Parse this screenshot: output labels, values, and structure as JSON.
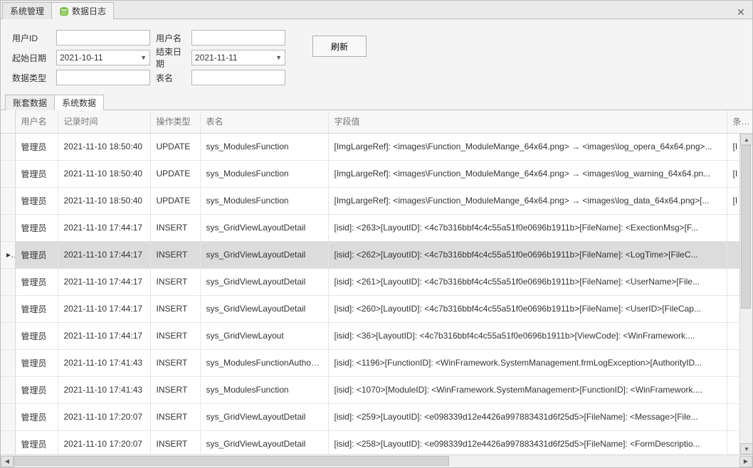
{
  "top_tabs": {
    "sys_mgmt": "系统管理",
    "data_log": "数据日志"
  },
  "close_glyph": "✕",
  "filter": {
    "user_id_label": "用户ID",
    "user_name_label": "用户名",
    "start_date_label": "起始日期",
    "start_date_value": "2021-10-11",
    "end_date_label": "结束日期",
    "end_date_value": "2021-11-11",
    "data_type_label": "数据类型",
    "table_name_label": "表名",
    "refresh_label": "刷新"
  },
  "inner_tabs": {
    "account_data": "账套数据",
    "system_data": "系统数据"
  },
  "grid": {
    "headers": {
      "user": "用户名",
      "time": "记录时间",
      "op": "操作类型",
      "table": "表名",
      "field": "字段值",
      "cond": "条件"
    },
    "row_indicator": "▸",
    "selected_index": 4,
    "rows": [
      {
        "user": "管理员",
        "time": "2021-11-10 18:50:40",
        "op": "UPDATE",
        "table": "sys_ModulesFunction",
        "field": "[ImgLargeRef]: <images\\Function_ModuleMange_64x64.png> → <images\\log_opera_64x64.png>...",
        "cond": "[I"
      },
      {
        "user": "管理员",
        "time": "2021-11-10 18:50:40",
        "op": "UPDATE",
        "table": "sys_ModulesFunction",
        "field": "[ImgLargeRef]: <images\\Function_ModuleMange_64x64.png> → <images\\log_warning_64x64.pn...",
        "cond": "[I"
      },
      {
        "user": "管理员",
        "time": "2021-11-10 18:50:40",
        "op": "UPDATE",
        "table": "sys_ModulesFunction",
        "field": "[ImgLargeRef]: <images\\Function_ModuleMange_64x64.png> → <images\\log_data_64x64.png>[...",
        "cond": "[I"
      },
      {
        "user": "管理员",
        "time": "2021-11-10 17:44:17",
        "op": "INSERT",
        "table": "sys_GridViewLayoutDetail",
        "field": "[isid]: <263>[LayoutID]: <4c7b316bbf4c4c55a51f0e0696b1911b>[FileName]: <ExectionMsg>[F...",
        "cond": ""
      },
      {
        "user": "管理员",
        "time": "2021-11-10 17:44:17",
        "op": "INSERT",
        "table": "sys_GridViewLayoutDetail",
        "field": "[isid]: <262>[LayoutID]: <4c7b316bbf4c4c55a51f0e0696b1911b>[FileName]: <LogTime>[FileC...",
        "cond": ""
      },
      {
        "user": "管理员",
        "time": "2021-11-10 17:44:17",
        "op": "INSERT",
        "table": "sys_GridViewLayoutDetail",
        "field": "[isid]: <261>[LayoutID]: <4c7b316bbf4c4c55a51f0e0696b1911b>[FileName]: <UserName>[File...",
        "cond": ""
      },
      {
        "user": "管理员",
        "time": "2021-11-10 17:44:17",
        "op": "INSERT",
        "table": "sys_GridViewLayoutDetail",
        "field": "[isid]: <260>[LayoutID]: <4c7b316bbf4c4c55a51f0e0696b1911b>[FileName]: <UserID>[FileCap...",
        "cond": ""
      },
      {
        "user": "管理员",
        "time": "2021-11-10 17:44:17",
        "op": "INSERT",
        "table": "sys_GridViewLayout",
        "field": "[isid]: <36>[LayoutID]: <4c7b316bbf4c4c55a51f0e0696b1911b>[ViewCode]: <WinFramework....",
        "cond": ""
      },
      {
        "user": "管理员",
        "time": "2021-11-10 17:41:43",
        "op": "INSERT",
        "table": "sys_ModulesFunctionAuthority",
        "field": "[isid]: <1196>[FunctionID]: <WinFramework.SystemManagement.frmLogException>[AuthorityID...",
        "cond": ""
      },
      {
        "user": "管理员",
        "time": "2021-11-10 17:41:43",
        "op": "INSERT",
        "table": "sys_ModulesFunction",
        "field": "[isid]: <1070>[ModuleID]: <WinFramework.SystemManagement>[FunctionID]: <WinFramework....",
        "cond": ""
      },
      {
        "user": "管理员",
        "time": "2021-11-10 17:20:07",
        "op": "INSERT",
        "table": "sys_GridViewLayoutDetail",
        "field": "[isid]: <259>[LayoutID]: <e098339d12e4426a997883431d6f25d5>[FileName]: <Message>[File...",
        "cond": ""
      },
      {
        "user": "管理员",
        "time": "2021-11-10 17:20:07",
        "op": "INSERT",
        "table": "sys_GridViewLayoutDetail",
        "field": "[isid]: <258>[LayoutID]: <e098339d12e4426a997883431d6f25d5>[FileName]: <FormDescriptio...",
        "cond": ""
      }
    ]
  }
}
